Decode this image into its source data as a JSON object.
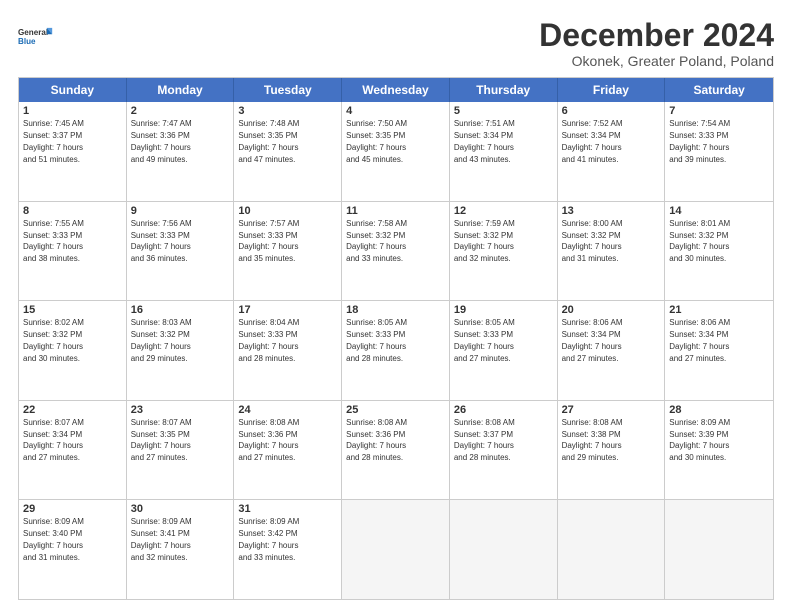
{
  "logo": {
    "line1": "General",
    "line2": "Blue"
  },
  "title": "December 2024",
  "subtitle": "Okonek, Greater Poland, Poland",
  "days": [
    "Sunday",
    "Monday",
    "Tuesday",
    "Wednesday",
    "Thursday",
    "Friday",
    "Saturday"
  ],
  "weeks": [
    [
      {
        "day": "1",
        "rise": "7:45 AM",
        "set": "3:37 PM",
        "dl": "7 hours and 51 minutes."
      },
      {
        "day": "2",
        "rise": "7:47 AM",
        "set": "3:36 PM",
        "dl": "7 hours and 49 minutes."
      },
      {
        "day": "3",
        "rise": "7:48 AM",
        "set": "3:35 PM",
        "dl": "7 hours and 47 minutes."
      },
      {
        "day": "4",
        "rise": "7:50 AM",
        "set": "3:35 PM",
        "dl": "7 hours and 45 minutes."
      },
      {
        "day": "5",
        "rise": "7:51 AM",
        "set": "3:34 PM",
        "dl": "7 hours and 43 minutes."
      },
      {
        "day": "6",
        "rise": "7:52 AM",
        "set": "3:34 PM",
        "dl": "7 hours and 41 minutes."
      },
      {
        "day": "7",
        "rise": "7:54 AM",
        "set": "3:33 PM",
        "dl": "7 hours and 39 minutes."
      }
    ],
    [
      {
        "day": "8",
        "rise": "7:55 AM",
        "set": "3:33 PM",
        "dl": "7 hours and 38 minutes."
      },
      {
        "day": "9",
        "rise": "7:56 AM",
        "set": "3:33 PM",
        "dl": "7 hours and 36 minutes."
      },
      {
        "day": "10",
        "rise": "7:57 AM",
        "set": "3:33 PM",
        "dl": "7 hours and 35 minutes."
      },
      {
        "day": "11",
        "rise": "7:58 AM",
        "set": "3:32 PM",
        "dl": "7 hours and 33 minutes."
      },
      {
        "day": "12",
        "rise": "7:59 AM",
        "set": "3:32 PM",
        "dl": "7 hours and 32 minutes."
      },
      {
        "day": "13",
        "rise": "8:00 AM",
        "set": "3:32 PM",
        "dl": "7 hours and 31 minutes."
      },
      {
        "day": "14",
        "rise": "8:01 AM",
        "set": "3:32 PM",
        "dl": "7 hours and 30 minutes."
      }
    ],
    [
      {
        "day": "15",
        "rise": "8:02 AM",
        "set": "3:32 PM",
        "dl": "7 hours and 30 minutes."
      },
      {
        "day": "16",
        "rise": "8:03 AM",
        "set": "3:32 PM",
        "dl": "7 hours and 29 minutes."
      },
      {
        "day": "17",
        "rise": "8:04 AM",
        "set": "3:33 PM",
        "dl": "7 hours and 28 minutes."
      },
      {
        "day": "18",
        "rise": "8:05 AM",
        "set": "3:33 PM",
        "dl": "7 hours and 28 minutes."
      },
      {
        "day": "19",
        "rise": "8:05 AM",
        "set": "3:33 PM",
        "dl": "7 hours and 27 minutes."
      },
      {
        "day": "20",
        "rise": "8:06 AM",
        "set": "3:34 PM",
        "dl": "7 hours and 27 minutes."
      },
      {
        "day": "21",
        "rise": "8:06 AM",
        "set": "3:34 PM",
        "dl": "7 hours and 27 minutes."
      }
    ],
    [
      {
        "day": "22",
        "rise": "8:07 AM",
        "set": "3:34 PM",
        "dl": "7 hours and 27 minutes."
      },
      {
        "day": "23",
        "rise": "8:07 AM",
        "set": "3:35 PM",
        "dl": "7 hours and 27 minutes."
      },
      {
        "day": "24",
        "rise": "8:08 AM",
        "set": "3:36 PM",
        "dl": "7 hours and 27 minutes."
      },
      {
        "day": "25",
        "rise": "8:08 AM",
        "set": "3:36 PM",
        "dl": "7 hours and 28 minutes."
      },
      {
        "day": "26",
        "rise": "8:08 AM",
        "set": "3:37 PM",
        "dl": "7 hours and 28 minutes."
      },
      {
        "day": "27",
        "rise": "8:08 AM",
        "set": "3:38 PM",
        "dl": "7 hours and 29 minutes."
      },
      {
        "day": "28",
        "rise": "8:09 AM",
        "set": "3:39 PM",
        "dl": "7 hours and 30 minutes."
      }
    ],
    [
      {
        "day": "29",
        "rise": "8:09 AM",
        "set": "3:40 PM",
        "dl": "7 hours and 31 minutes."
      },
      {
        "day": "30",
        "rise": "8:09 AM",
        "set": "3:41 PM",
        "dl": "7 hours and 32 minutes."
      },
      {
        "day": "31",
        "rise": "8:09 AM",
        "set": "3:42 PM",
        "dl": "7 hours and 33 minutes."
      },
      null,
      null,
      null,
      null
    ]
  ]
}
